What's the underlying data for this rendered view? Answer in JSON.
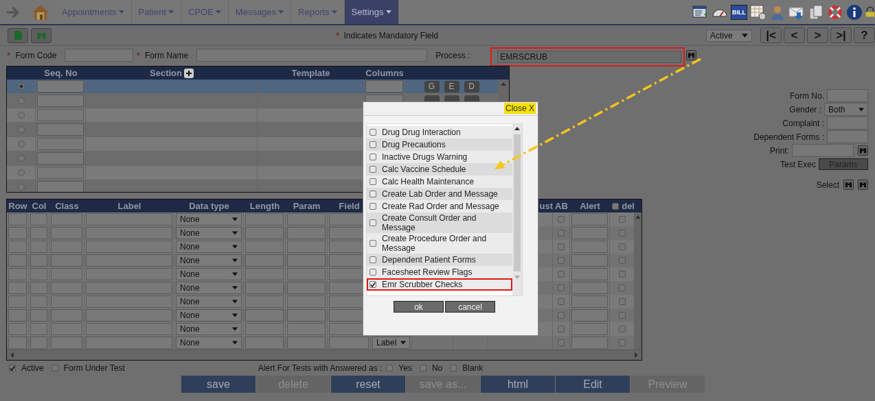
{
  "nav": {
    "items": [
      {
        "label": "Appointments",
        "selected": false
      },
      {
        "label": "Patient",
        "selected": false
      },
      {
        "label": "CPOE",
        "selected": false
      },
      {
        "label": "Messages",
        "selected": false
      },
      {
        "label": "Reports",
        "selected": false
      },
      {
        "label": "Settings",
        "selected": true
      }
    ],
    "bill_icon_text": "BILL"
  },
  "toolbar": {
    "mandatory_mark": "*",
    "mandatory_note": "Indicates Mandatory Field",
    "status_select": "Active",
    "pager": [
      "|<",
      "<",
      ">",
      ">|",
      "?"
    ]
  },
  "form": {
    "form_code_mark": "*",
    "form_code_label": "Form Code",
    "form_name_mark": "*",
    "form_name_label": "Form Name",
    "process_label": "Process :",
    "process_value": "EMRSCRUB",
    "process_highlighted": true
  },
  "sections_table": {
    "columns": [
      "Seq. No",
      "Section",
      "Template",
      "Columns"
    ],
    "rows": [
      {
        "selected": true,
        "kind": "buttons",
        "buttons": [
          "G",
          "E",
          "D"
        ]
      },
      {
        "selected": false,
        "kind": "covered_buttons"
      },
      {
        "selected": false
      },
      {
        "selected": false
      },
      {
        "selected": false
      },
      {
        "selected": false
      },
      {
        "selected": false
      },
      {
        "selected": false
      }
    ]
  },
  "side_form": {
    "form_no_label": "Form No.",
    "gender_label": "Gender :",
    "gender_value": "Both",
    "complaint_label": "Complaint :",
    "dependent_label": "Dependent Forms :",
    "print_label": "Print:",
    "test_exec_label": "Test Exec",
    "params_button": "Params",
    "select_label": "Select"
  },
  "fields_table": {
    "columns": [
      "Row",
      "Col",
      "Class",
      "Label",
      "Data type",
      "Length",
      "Param",
      "Field"
    ],
    "columns_right": [
      "ust",
      "AB",
      "Alert"
    ],
    "select_all_checked": false,
    "del_label": "del",
    "rows": [
      {
        "data_type": "None",
        "ab_checked": false,
        "del_checked": false
      },
      {
        "data_type": "None",
        "ab_checked": false,
        "del_checked": false
      },
      {
        "data_type": "None",
        "ab_checked": false,
        "del_checked": false
      },
      {
        "data_type": "None",
        "ab_checked": false,
        "del_checked": false
      },
      {
        "data_type": "None",
        "ab_checked": false,
        "del_checked": false
      },
      {
        "data_type": "None",
        "ab_checked": false,
        "del_checked": false
      },
      {
        "data_type": "None",
        "ab_checked": false,
        "del_checked": false
      },
      {
        "data_type": "None",
        "ab_checked": false,
        "del_checked": false
      },
      {
        "data_type": "None",
        "ab_checked": false,
        "del_checked": false
      },
      {
        "data_type": "None",
        "column_9": "Label",
        "ab_checked": false,
        "del_checked": false
      }
    ]
  },
  "footer": {
    "checks": [
      {
        "label": "Active",
        "checked": true
      },
      {
        "label": "Form Under Test",
        "checked": false
      }
    ],
    "alert_label": "Alert For Tests with Answered as :",
    "alert_options": [
      {
        "label": "Yes",
        "checked": false
      },
      {
        "label": "No",
        "checked": false
      },
      {
        "label": "Blank",
        "checked": false
      }
    ]
  },
  "buttons": [
    {
      "label": "save",
      "disabled": false
    },
    {
      "label": "delete",
      "disabled": true
    },
    {
      "label": "reset",
      "disabled": false
    },
    {
      "label": "save as...",
      "disabled": true
    },
    {
      "label": "html",
      "disabled": false
    },
    {
      "label": "Edit",
      "disabled": false
    },
    {
      "label": "Preview",
      "disabled": true
    }
  ],
  "popup": {
    "close": "Close X",
    "items": [
      {
        "label": "Drug Drug Interaction",
        "checked": false,
        "highlighted": false
      },
      {
        "label": "Drug Precautions",
        "checked": false,
        "highlighted": false
      },
      {
        "label": "Inactive Drugs Warning",
        "checked": false,
        "highlighted": false
      },
      {
        "label": "Calc Vaccine Schedule",
        "checked": false,
        "highlighted": false
      },
      {
        "label": "Calc Health Maintenance",
        "checked": false,
        "highlighted": false
      },
      {
        "label": "Create Lab Order and Message",
        "checked": false,
        "highlighted": false
      },
      {
        "label": "Create Rad Order and Message",
        "checked": false,
        "highlighted": false
      },
      {
        "label": "Create Consult Order and Message",
        "checked": false,
        "highlighted": false
      },
      {
        "label": "Create Procedure Order and Message",
        "checked": false,
        "highlighted": false
      },
      {
        "label": "Dependent Patient Forms",
        "checked": false,
        "highlighted": false
      },
      {
        "label": "Facesheet Review Flags",
        "checked": false,
        "highlighted": false
      },
      {
        "label": "Emr Scrubber Checks",
        "checked": true,
        "highlighted": true
      }
    ],
    "ok": "ok",
    "cancel": "cancel"
  }
}
